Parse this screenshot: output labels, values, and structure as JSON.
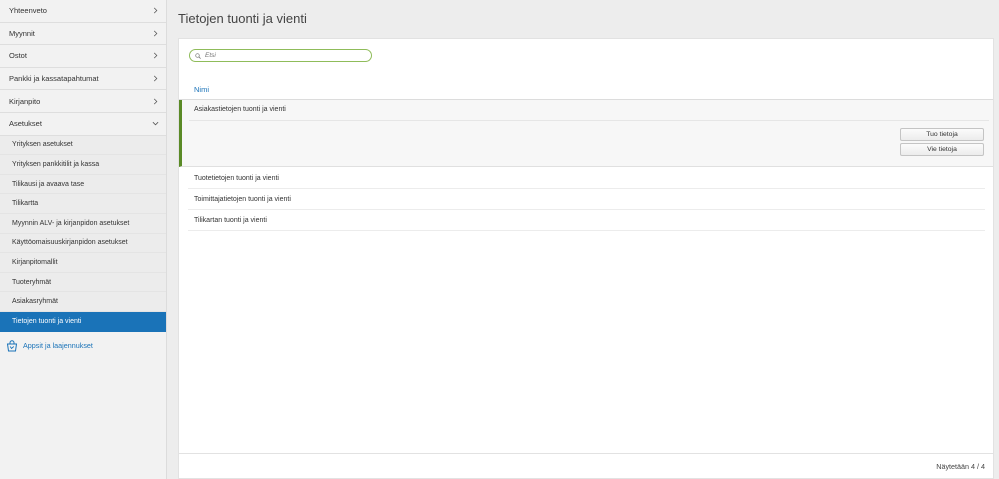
{
  "sidebar": {
    "nav": [
      {
        "label": "Yhteenveto"
      },
      {
        "label": "Myynnit"
      },
      {
        "label": "Ostot"
      },
      {
        "label": "Pankki ja kassatapahtumat"
      },
      {
        "label": "Kirjanpito"
      },
      {
        "label": "Asetukset"
      }
    ],
    "sub_items": [
      {
        "label": "Yrityksen asetukset"
      },
      {
        "label": "Yrityksen pankkitilit ja kassa"
      },
      {
        "label": "Tilikausi ja avaava tase"
      },
      {
        "label": "Tilikartta"
      },
      {
        "label": "Myynnin ALV- ja kirjanpidon asetukset"
      },
      {
        "label": "Käyttöomaisuuskirjanpidon asetukset"
      },
      {
        "label": "Kirjanpitomallit"
      },
      {
        "label": "Tuoteryhmät"
      },
      {
        "label": "Asiakasryhmät"
      },
      {
        "label": "Tietojen tuonti ja vienti"
      }
    ],
    "apps_label": "Appsit ja laajennukset"
  },
  "header": {
    "title": "Tietojen tuonti ja vienti"
  },
  "search": {
    "placeholder": "Etsi"
  },
  "table": {
    "column": "Nimi",
    "expanded_row": {
      "label": "Asiakastietojen tuonti ja vienti",
      "import_label": "Tuo tietoja",
      "export_label": "Vie tietoja"
    },
    "rows": [
      {
        "label": "Tuotetietojen tuonti ja vienti"
      },
      {
        "label": "Toimittajatietojen tuonti ja vienti"
      },
      {
        "label": "Tilikartan tuonti ja vienti"
      }
    ]
  },
  "footer": {
    "status": "Näytetään 4 / 4"
  },
  "colors": {
    "accent": "#1a73b8",
    "expanded_bar": "#5a8a26",
    "search_border": "#8fbc5a"
  }
}
